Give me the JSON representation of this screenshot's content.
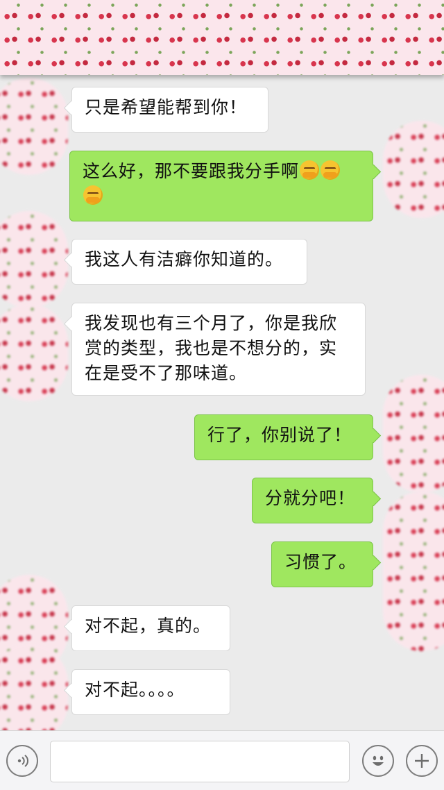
{
  "messages": [
    {
      "side": "in",
      "text": "只是希望能帮到你！"
    },
    {
      "side": "out",
      "text": "这么好，那不要跟我分手啊"
    },
    {
      "side": "in",
      "text": "我这人有洁癖你知道的。"
    },
    {
      "side": "in",
      "text": "我发现也有三个月了，你是我欣赏的类型，我也是不想分的，实在是受不了那味道。"
    },
    {
      "side": "out",
      "text": "行了，你别说了！"
    },
    {
      "side": "out",
      "text": "分就分吧！"
    },
    {
      "side": "out",
      "text": "习惯了。"
    },
    {
      "side": "in",
      "text": "对不起，真的。"
    },
    {
      "side": "in",
      "text": "对不起。。。。"
    }
  ],
  "emoji_name": "frowning-face-emoji",
  "colors": {
    "chat_background": "#ebebeb",
    "incoming_bubble": "#ffffff",
    "outgoing_bubble": "#9fe75f",
    "input_bar": "#f4f4f6"
  },
  "input_bar": {
    "voice_icon": "voice-icon",
    "emoji_icon": "smiley-icon",
    "plus_icon": "plus-icon"
  }
}
